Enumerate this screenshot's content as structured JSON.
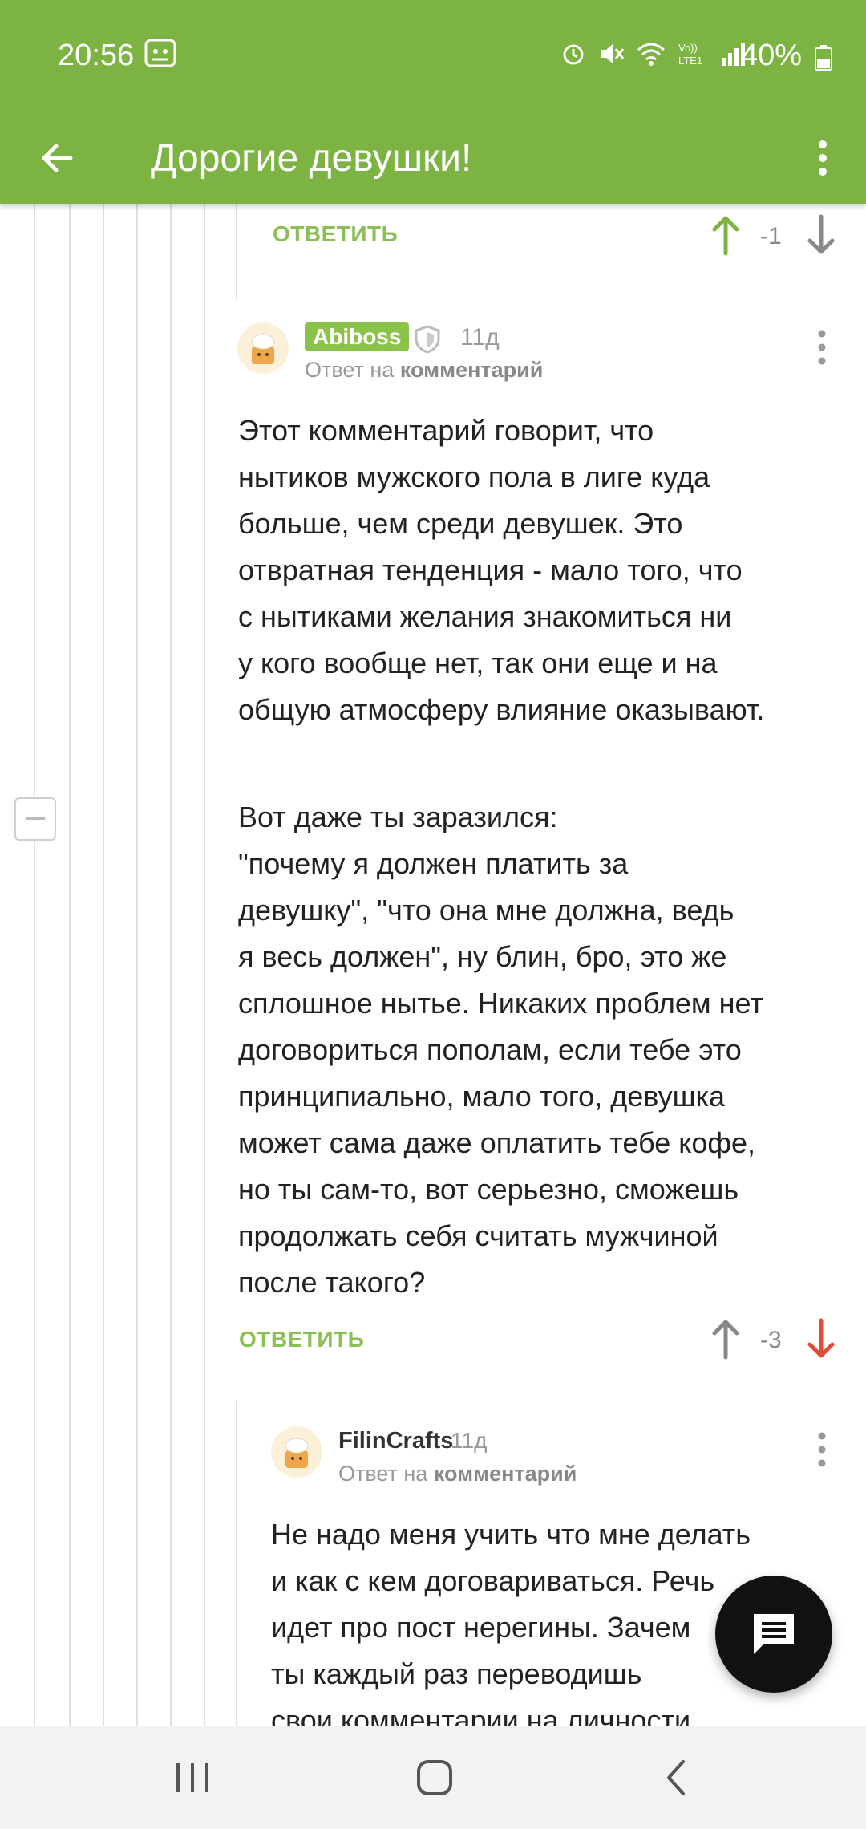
{
  "status_bar": {
    "time": "20:56",
    "battery": "40%",
    "icons": [
      "ghost-icon",
      "alarm-icon",
      "mute-icon",
      "wifi-icon",
      "volte-icon",
      "signal-icon",
      "battery-icon"
    ]
  },
  "app_bar": {
    "title": "Дорогие девушки!",
    "icons": [
      "back-arrow-icon",
      "more-vert-icon"
    ]
  },
  "top_comment_actions": {
    "reply_label": "ОТВЕТИТЬ",
    "score": "-1"
  },
  "comment_1": {
    "author": "Abiboss",
    "time": "11д",
    "reply_to_prefix": "Ответ на",
    "reply_to_link": "комментарий",
    "paragraph_1": "Этот комментарий говорит, что\nнытиков мужского пола в лиге куда\nбольше, чем среди девушек. Это\nотвратная тенденция - мало того, что\nс нытиками желания знакомиться ни\nу кого вообще нет, так они еще и на\nобщую атмосферу влияние оказывают.",
    "paragraph_2": "Вот даже ты заразился:\n\"почему я должен платить за\nдевушку\", \"что она мне должна, ведь\nя весь должен\", ну блин, бро, это же\nсплошное нытье. Никаких проблем нет\nдоговориться пополам, если тебе это\nпринципиально, мало того, девушка\nможет сама даже оплатить тебе кофе,\nно ты сам-то, вот серьезно, сможешь\nпродолжать себя считать мужчиной\nпосле такого?",
    "reply_label": "ОТВЕТИТЬ",
    "score": "-3"
  },
  "comment_2": {
    "author": "FilinCrafts",
    "time": "11д",
    "reply_to_prefix": "Ответ на",
    "reply_to_link": "комментарий",
    "body": "Не надо меня учить что мне делать\nи как с кем договариваться. Речь\nидет про пост нерегины. Зачем\nты каждый раз переводишь\nсвои комментарии на личности"
  },
  "colors": {
    "accent_green": "#7cb342",
    "upvote_active": "#7cb342",
    "downvote_active": "#e04b3a",
    "neutral_vote": "#888888"
  }
}
